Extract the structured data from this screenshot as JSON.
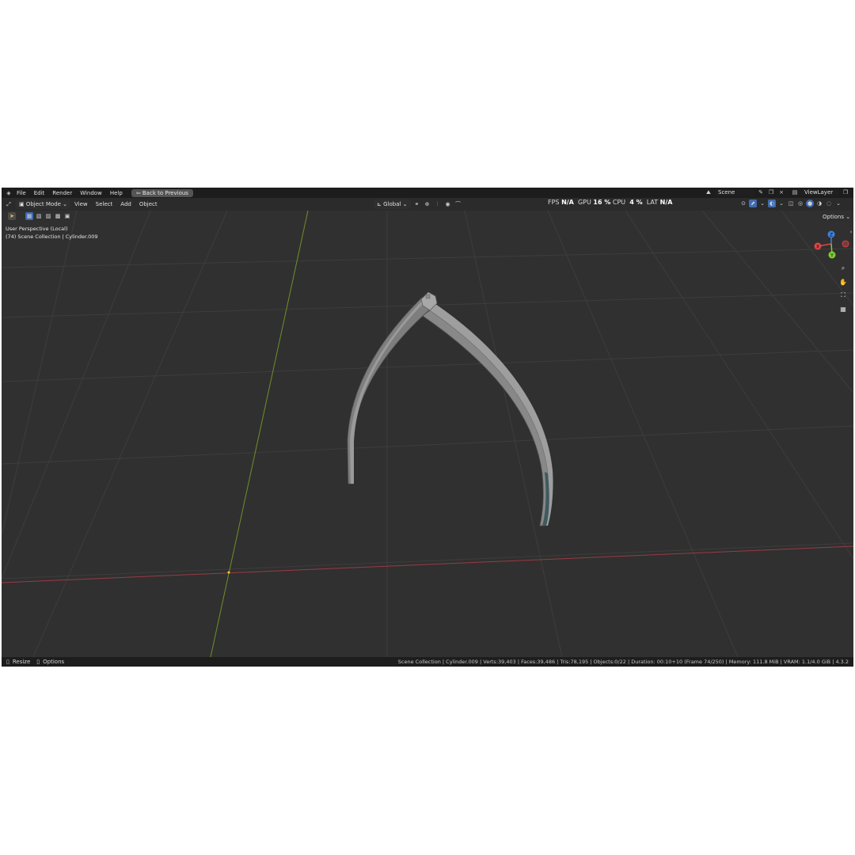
{
  "topbar": {
    "menus": [
      "File",
      "Edit",
      "Render",
      "Window",
      "Help"
    ],
    "back_button": "Back to Previous",
    "scene": "Scene",
    "view_layer": "ViewLayer"
  },
  "header": {
    "mode": "Object Mode",
    "menus": [
      "View",
      "Select",
      "Add",
      "Object"
    ],
    "transform_orientation": "Global",
    "options": "Options"
  },
  "perf": {
    "fps_label": "FPS",
    "fps_value": "N/A",
    "gpu_label": "GPU",
    "gpu_value": "16 %",
    "cpu_label": "CPU",
    "cpu_value": "4 %",
    "lat_label": "LAT",
    "lat_value": "N/A"
  },
  "overlay": {
    "line1": "User Perspective (Local)",
    "line2": "(74) Scene Collection | Cylinder.009"
  },
  "gizmo": {
    "z": "Z",
    "x": "X",
    "y": "Y"
  },
  "statusbar": {
    "left1": "Resize",
    "left2": "Options",
    "right": "Scene Collection | Cylinder.009 | Verts:39,403 | Faces:39,486 | Tris:78,195 | Objects:0/22 | Duration: 00:10+10 (Frame 74/250) | Memory: 111.8 MiB | VRAM: 1.1/4.0 GiB | 4.3.2"
  },
  "colors": {
    "bg": "#303030",
    "grid": "#3c3c3c",
    "axis_x": "#9a3a44",
    "axis_y": "#6f8f2a",
    "object": "#8a8a8a",
    "gizmo_x": "#e04545",
    "gizmo_y": "#7ccf2f",
    "gizmo_z": "#3b82e0"
  }
}
